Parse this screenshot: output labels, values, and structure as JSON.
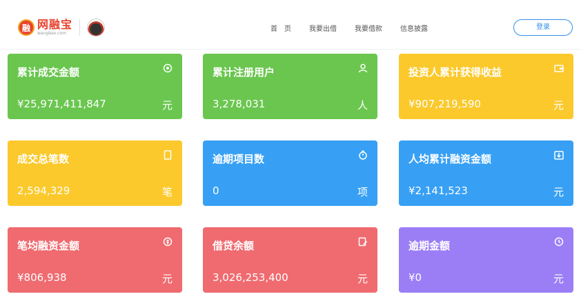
{
  "header": {
    "logo_mark": "融",
    "logo_name": "网融宝",
    "logo_domain": "wangbao.com",
    "nav": [
      "首　页",
      "我要出借",
      "我要借款",
      "信息披露"
    ],
    "login_label": "登录"
  },
  "colors": {
    "green": "#6ac64f",
    "yellow": "#fbc92c",
    "blue": "#37a0f4",
    "red": "#ef6b70",
    "purple": "#9b7ef6",
    "login": "#2f8ee8"
  },
  "cards": [
    {
      "title": "累计成交金额",
      "value": "¥25,971,411,847",
      "unit": "元",
      "icon": "target-icon"
    },
    {
      "title": "累计注册用户",
      "value": "3,278,031",
      "unit": "人",
      "icon": "user-icon"
    },
    {
      "title": "投资人累计获得收益",
      "value": "¥907,219,590",
      "unit": "元",
      "icon": "wallet-icon"
    },
    {
      "title": "成交总笔数",
      "value": "2,594,329",
      "unit": "笔",
      "icon": "document-icon"
    },
    {
      "title": "逾期项目数",
      "value": "0",
      "unit": "项",
      "icon": "stopwatch-icon"
    },
    {
      "title": "人均累计融资金额",
      "value": "¥2,141,523",
      "unit": "元",
      "icon": "download-icon"
    },
    {
      "title": "笔均融资金额",
      "value": "¥806,938",
      "unit": "元",
      "icon": "coin-icon"
    },
    {
      "title": "借贷余额",
      "value": "3,026,253,400",
      "unit": "元",
      "icon": "edit-icon"
    },
    {
      "title": "逾期金额",
      "value": "¥0",
      "unit": "元",
      "icon": "clock-icon"
    }
  ]
}
